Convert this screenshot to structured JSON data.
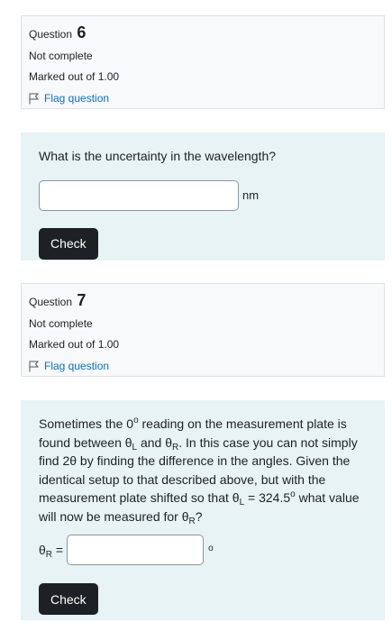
{
  "q6": {
    "label": "Question",
    "number": "6",
    "state": "Not complete",
    "grade": "Marked out of 1.00",
    "flag": "Flag question",
    "text": "What is the uncertainty in the wavelength?",
    "answer_value": "",
    "unit": "nm",
    "check": "Check"
  },
  "q7": {
    "label": "Question",
    "number": "7",
    "state": "Not complete",
    "grade": "Marked out of 1.00",
    "flag": "Flag question",
    "text": {
      "p1": "Sometimes the 0",
      "deg1": "o",
      "p2": " reading on the measurement plate is found between θ",
      "subL1": "L",
      "p3": " and θ",
      "subR1": "R",
      "p4": ". In this case you can not simply find 2θ by finding the difference in the angles. Given the identical setup to that described above, but with the measurement plate shifted so that θ",
      "subL2": "L",
      "p5": " = 324.5",
      "deg2": "o",
      "p6": " what value will now be measured for θ",
      "subR2": "R",
      "p7": "?"
    },
    "prefix_theta": "θ",
    "prefix_sub": "R",
    "prefix_eq": " =",
    "answer_value": "",
    "unit": "o",
    "check": "Check"
  },
  "colors": {
    "info_bg": "#f8f9fa",
    "content_bg": "#e7f3f5",
    "flag_link": "#0f6cbf",
    "button_bg": "#1d2125"
  },
  "icons": {
    "flag": "flag-outline-icon"
  }
}
